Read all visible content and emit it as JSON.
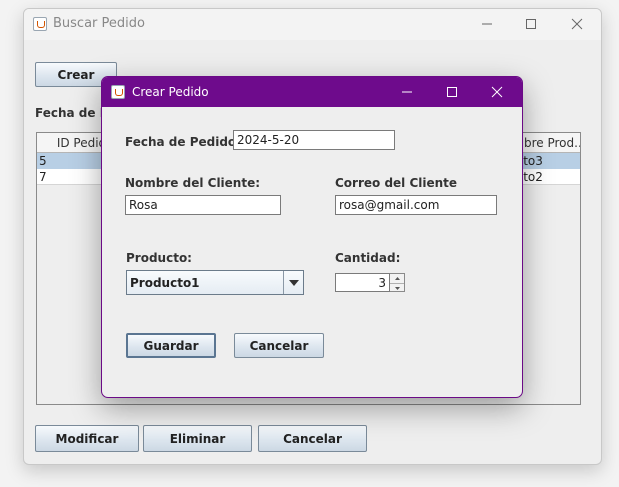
{
  "main_window": {
    "title": "Buscar Pedido",
    "crear_label": "Crear",
    "fecha_label": "Fecha de Pe",
    "table": {
      "headers": [
        "ID Pedid",
        "bre Prod..."
      ],
      "rows": [
        {
          "id": "5",
          "producto": "ucto3"
        },
        {
          "id": "7",
          "producto": "ucto2"
        }
      ]
    },
    "modificar_label": "Modificar",
    "eliminar_label": "Eliminar",
    "cancelar_label": "Cancelar"
  },
  "dialog": {
    "title": "Crear Pedido",
    "fecha_label": "Fecha de Pedido:",
    "fecha_value": "2024-5-20",
    "nombre_label": "Nombre del Cliente:",
    "nombre_value": "Rosa",
    "correo_label": "Correo del Cliente",
    "correo_value": "rosa@gmail.com",
    "producto_label": "Producto:",
    "producto_value": "Producto1",
    "cantidad_label": "Cantidad:",
    "cantidad_value": "3",
    "guardar_label": "Guardar",
    "cancelar_label": "Cancelar"
  },
  "colors": {
    "dialog_titlebar": "#6e0b8c",
    "selected_row": "#b8cfe5"
  },
  "icons": [
    "java-app-icon",
    "minimize-icon",
    "maximize-icon",
    "close-icon",
    "dropdown-arrow-icon",
    "spinner-up-icon",
    "spinner-down-icon"
  ]
}
